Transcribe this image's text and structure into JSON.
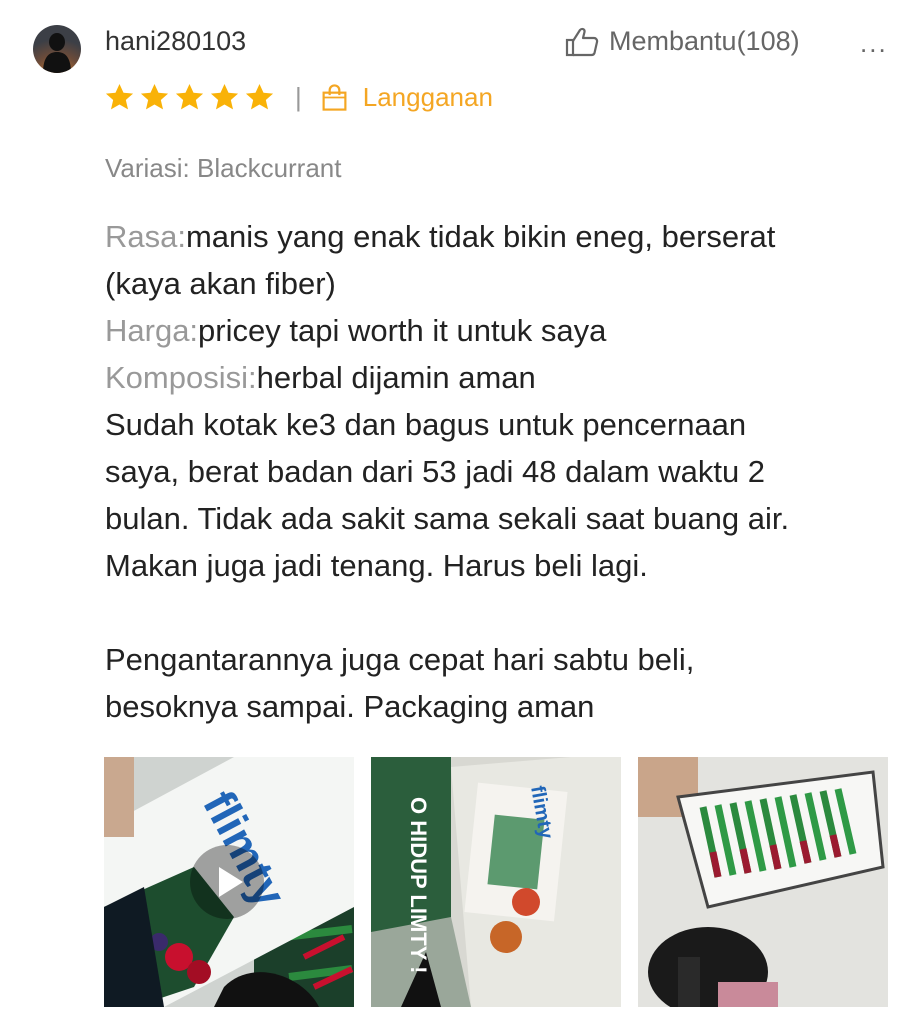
{
  "review": {
    "username": "hani280103",
    "helpful_label": "Membantu(108)",
    "more_label": "...",
    "rating": 5,
    "rating_max": 5,
    "subscription_label": "Langganan",
    "variant_label": "Variasi: Blackcurrant",
    "attributes": [
      {
        "label": "Rasa:",
        "value": "manis yang enak tidak bikin eneg, berserat"
      },
      {
        "label": "Harga:",
        "value": "pricey tapi worth it untuk saya"
      },
      {
        "label": "Komposisi:",
        "value": "herbal dijamin aman"
      }
    ],
    "attribute_continuation": "(kaya akan fiber)",
    "body_lines": [
      "Sudah kotak ke3 dan bagus untuk pencernaan",
      "saya, berat badan dari 53 jadi 48 dalam waktu 2",
      "bulan. Tidak ada sakit sama sekali saat buang air.",
      "Makan juga jadi tenang. Harus beli lagi."
    ],
    "body_lines_2": [
      "Pengantarannya juga cepat hari sabtu beli,",
      "besoknya sampai. Packaging aman"
    ],
    "media": [
      {
        "type": "video",
        "icon": "play-icon",
        "brand_text": "flimty"
      },
      {
        "type": "image",
        "brand_text": "flimty",
        "side_text": "O HIDUP LIMTY !"
      },
      {
        "type": "image"
      }
    ]
  },
  "colors": {
    "star": "#f9b208",
    "accent": "#f4a623",
    "muted": "#999999",
    "text": "#222222"
  },
  "icons": {
    "helpful": "thumbs-up-icon",
    "subscription": "shopping-bag-icon",
    "rating": "star-icon",
    "more": "ellipsis-icon"
  }
}
